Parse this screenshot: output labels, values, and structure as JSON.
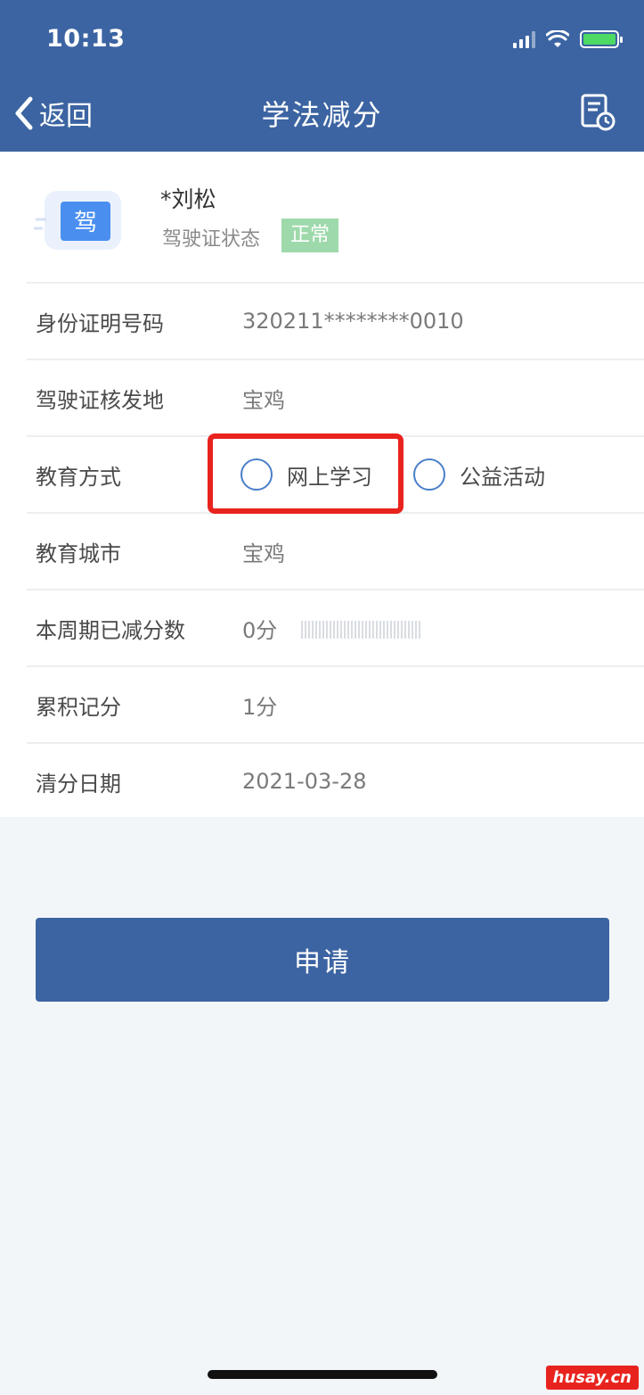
{
  "status_bar": {
    "time": "10:13"
  },
  "nav": {
    "back_label": "返回",
    "title": "学法减分",
    "record_icon": "document-clock-icon"
  },
  "profile": {
    "icon_text": "驾",
    "name": "*刘松",
    "license_status_label": "驾驶证状态",
    "license_status_value": "正常",
    "badge_color": "#9ed9ab"
  },
  "rows": {
    "id_number": {
      "label": "身份证明号码",
      "value": "320211********0010"
    },
    "issue_place": {
      "label": "驾驶证核发地",
      "value": "宝鸡"
    },
    "education_method": {
      "label": "教育方式",
      "options": [
        "网上学习",
        "公益活动"
      ]
    },
    "education_city": {
      "label": "教育城市",
      "value": "宝鸡"
    },
    "deducted": {
      "label": "本周期已减分数",
      "value": "0分"
    },
    "accumulated": {
      "label": "累积记分",
      "value": "1分"
    },
    "clear_date": {
      "label": "清分日期",
      "value": "2021-03-28"
    }
  },
  "apply_button": {
    "label": "申请"
  },
  "watermark": "husay.cn",
  "colors": {
    "primary": "#3c64a2",
    "highlight": "#e8231e"
  }
}
